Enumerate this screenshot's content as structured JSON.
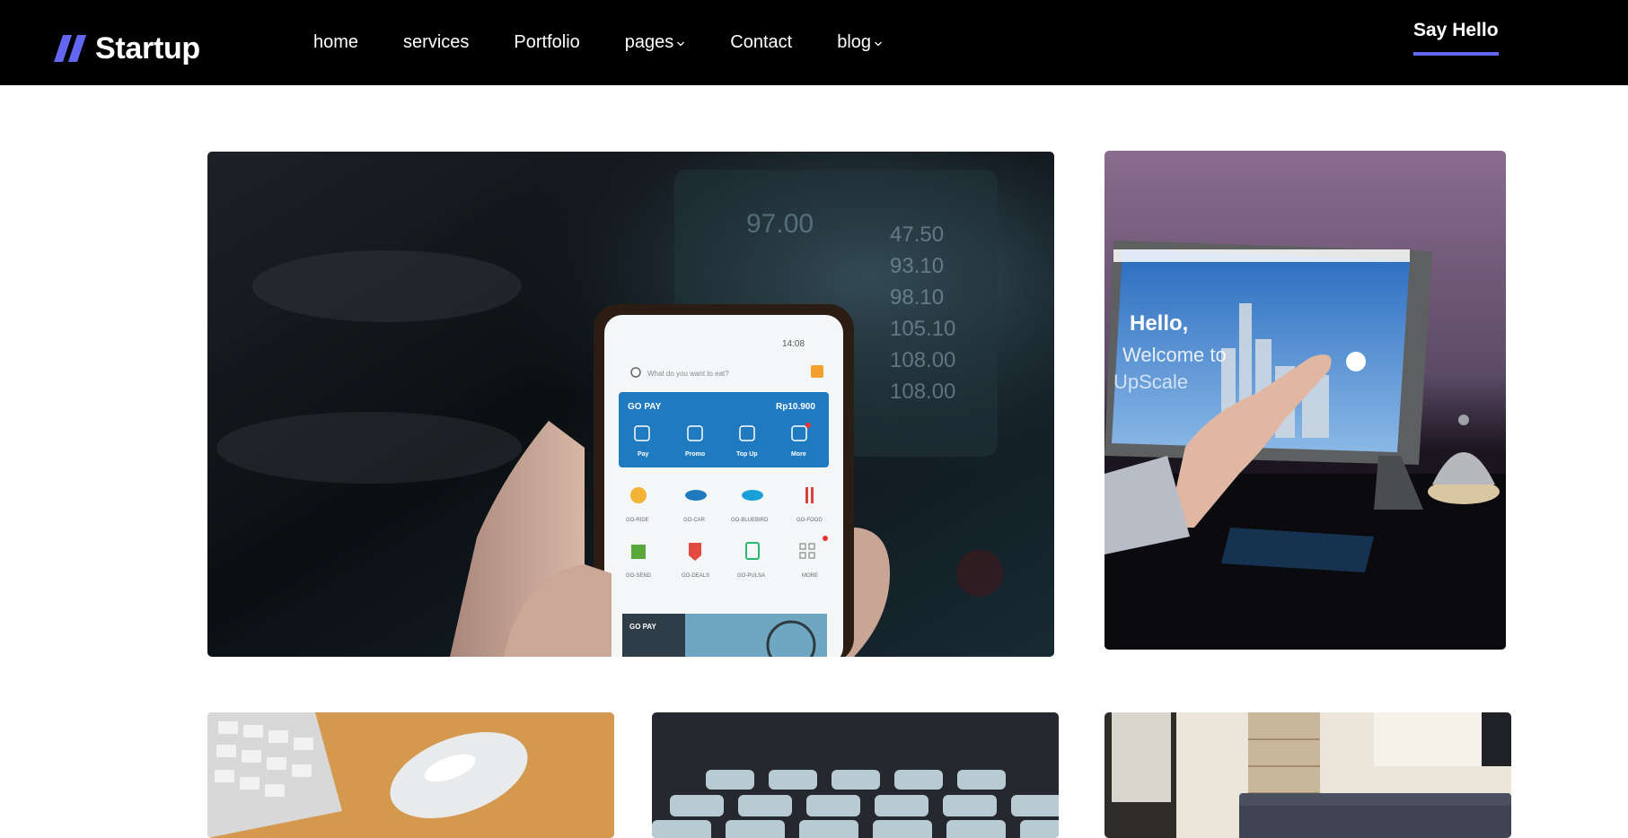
{
  "brand": {
    "name": "Startup",
    "accent": "#6366f1"
  },
  "nav": {
    "items": [
      {
        "label": "home",
        "dropdown": false
      },
      {
        "label": "services",
        "dropdown": false
      },
      {
        "label": "Portfolio",
        "dropdown": false
      },
      {
        "label": "pages",
        "dropdown": true
      },
      {
        "label": "Contact",
        "dropdown": false
      },
      {
        "label": "blog",
        "dropdown": true
      }
    ],
    "cta": "Say Hello"
  },
  "portfolio": {
    "items": [
      {
        "image": "phone-app-in-car",
        "screen": {
          "search_placeholder": "What do you want to eat?",
          "wallet": "GO PAY",
          "balance": "Rp10.900",
          "actions": [
            "Pay",
            "Promo",
            "Top Up",
            "More"
          ],
          "services": [
            "GO-RIDE",
            "GO-CAR",
            "GO-BLUEBIRD",
            "GO-FOOD",
            "GO-SEND",
            "GO-DEALS",
            "GO-PULSA",
            "MORE"
          ],
          "banner": "GO PAY",
          "status_time": "14:08"
        }
      },
      {
        "image": "tablet-checkin-kiosk",
        "screen": {
          "headline": "Hello,",
          "subline": "Welcome to",
          "brand": "UpScale"
        }
      },
      {
        "image": "keyboard-and-mouse"
      },
      {
        "image": "conference-chairs"
      },
      {
        "image": "office-lounge"
      }
    ]
  }
}
